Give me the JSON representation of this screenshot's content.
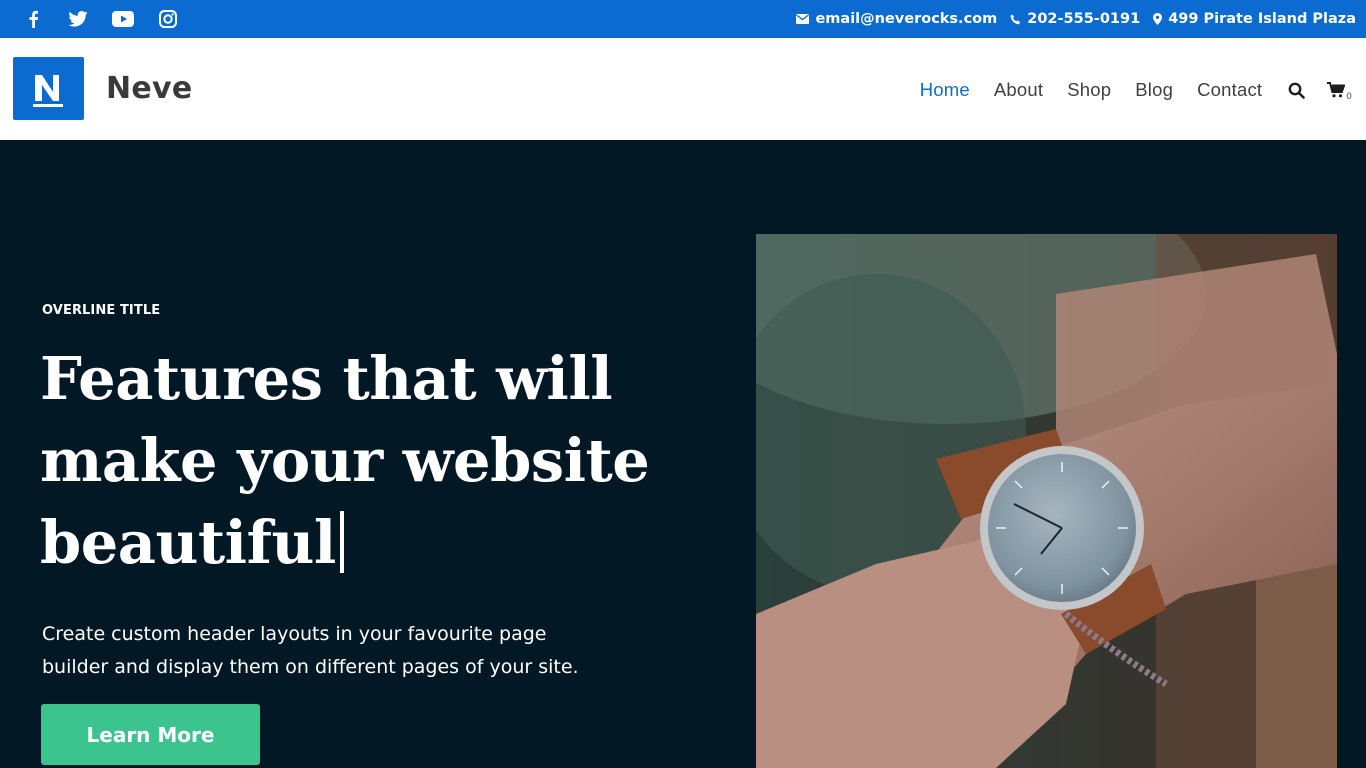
{
  "topbar": {
    "social_icons": [
      "facebook-icon",
      "twitter-icon",
      "youtube-icon",
      "instagram-icon"
    ],
    "email": "email@neverocks.com",
    "phone": "202-555-0191",
    "address": "499 Pirate Island Plaza"
  },
  "header": {
    "logo_letter": "N",
    "brand": "Neve",
    "nav": [
      "Home",
      "About",
      "Shop",
      "Blog",
      "Contact"
    ],
    "active_nav": "Home",
    "cart_count": "0"
  },
  "hero": {
    "overline": "OVERLINE TITLE",
    "title_lines": [
      "Features that will",
      "make your website",
      "beautiful"
    ],
    "subtitle_lines": [
      "Create custom header layouts in your favourite page",
      "builder and display them on different pages of your site."
    ],
    "button": "Learn More",
    "image_alt_icon": "wristwatch-photo"
  },
  "colors": {
    "topbar": "#0c6bd0",
    "hero_bg": "#021925",
    "button": "#3cc48e",
    "nav_active": "#0c6bd0"
  }
}
